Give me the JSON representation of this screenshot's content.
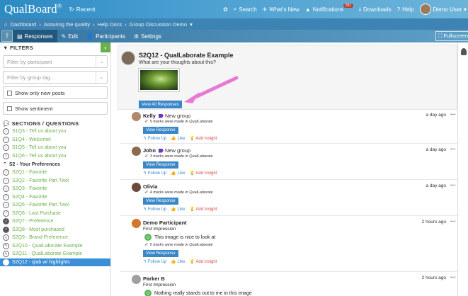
{
  "app": {
    "brand": "QualBoard",
    "brand_mark": "®",
    "recent": "Recent"
  },
  "topnav": {
    "search": "Search",
    "whats_new": "What's New",
    "notifications": "Notifications",
    "notifications_count": "281",
    "downloads": "Downloads",
    "help": "Help",
    "user": "Demo User"
  },
  "breadcrumb": [
    "Dashboard",
    "Assuring the quality",
    "Help Docs",
    "Group Discussion Demo"
  ],
  "toolbar": {
    "responses": "Responses",
    "edit": "Edit",
    "participants": "Participants",
    "settings": "Settings",
    "fullscreen": "Fullscreen"
  },
  "sidebar": {
    "filters_title": "FILTERS",
    "participant_placeholder": "Filter by participant",
    "group_placeholder": "Filter by group tag...",
    "show_new": "Show only new posts",
    "show_sentiment": "Show sentiment",
    "sections_title": "SECTIONS / QUESTIONS",
    "items_before": [
      {
        "label": "S1Q3 - Tell us about you",
        "icon": "○"
      },
      {
        "label": "S1Q4 - Welcome!",
        "icon": "i"
      },
      {
        "label": "S1Q5 - Tell us about you",
        "icon": "○"
      },
      {
        "label": "S1Q6 - Tell us about you",
        "icon": "○"
      }
    ],
    "group_label": "S2 - Your Preferences",
    "items_after": [
      {
        "label": "S2Q1 - Favorite",
        "icon": "○"
      },
      {
        "label": "S2Q2 - Favorite Part Two!",
        "icon": "○"
      },
      {
        "label": "S2Q3 - Favorite",
        "icon": "○"
      },
      {
        "label": "S2Q4 - Favorite",
        "icon": "○"
      },
      {
        "label": "S2Q5 - Favorite Part Two!",
        "icon": "○"
      },
      {
        "label": "S2Q6 - Last Purchase",
        "icon": "○"
      },
      {
        "label": "S2Q7 - Preference",
        "icon": "✓"
      },
      {
        "label": "S2Q8 - Most purchased",
        "icon": "✓"
      },
      {
        "label": "S2Q9 - Brand Preference",
        "icon": "≡"
      },
      {
        "label": "S2Q10 - QualLaborate Example",
        "icon": "✎"
      },
      {
        "label": "S2Q11 - QualLaborate Example",
        "icon": "✎"
      }
    ],
    "active_item": {
      "label": "S2Q12 - qlab w/ highlights",
      "icon": "✎"
    }
  },
  "question": {
    "title": "S2Q12 - QualLaborate Example",
    "prompt": "What are your thoughts about this?",
    "view_all": "View All Responses"
  },
  "responses": [
    {
      "name": "Kelly",
      "group": "New group",
      "time": "a day ago",
      "marks": "5 marks were made in QualLaborate",
      "view": "View Response",
      "follow": "Follow Up",
      "like": "Like",
      "insight": "Add Insight",
      "avatar_color": "#b08968"
    },
    {
      "name": "John",
      "group": "New group",
      "time": "a day ago",
      "marks": "3 marks were made in QualLaborate",
      "view": "View Response",
      "follow": "Follow Up",
      "like": "Like",
      "insight": "Add Insight",
      "avatar_color": "#8c6a4f"
    },
    {
      "name": "Olivia",
      "group": "",
      "time": "a day ago",
      "marks": "4 marks were made in QualLaborate",
      "view": "View Response",
      "follow": "Follow Up",
      "like": "Like",
      "insight": "Add Insight",
      "avatar_color": "#6b4c3b"
    },
    {
      "name": "Demo Participant",
      "group": "",
      "time": "2 hours ago",
      "label": "First Impression",
      "sentiment": "This image is nice to look at",
      "marks": "5 marks were made in QualLaborate",
      "view": "View Response",
      "follow": "Follow Up",
      "like": "Like",
      "insight": "Add Insight",
      "avatar_color": "#d4762c"
    },
    {
      "name": "Parker B",
      "group": "",
      "time": "2 hours ago",
      "label": "First Impression",
      "sentiment": "Nothing really stands out to me in this image",
      "avatar_color": "#a0a0a0"
    }
  ],
  "colors": {
    "accent": "#3a87c8",
    "green": "#6ab04c",
    "insight_red": "#d94848",
    "group_purple": "#6a35c1"
  }
}
